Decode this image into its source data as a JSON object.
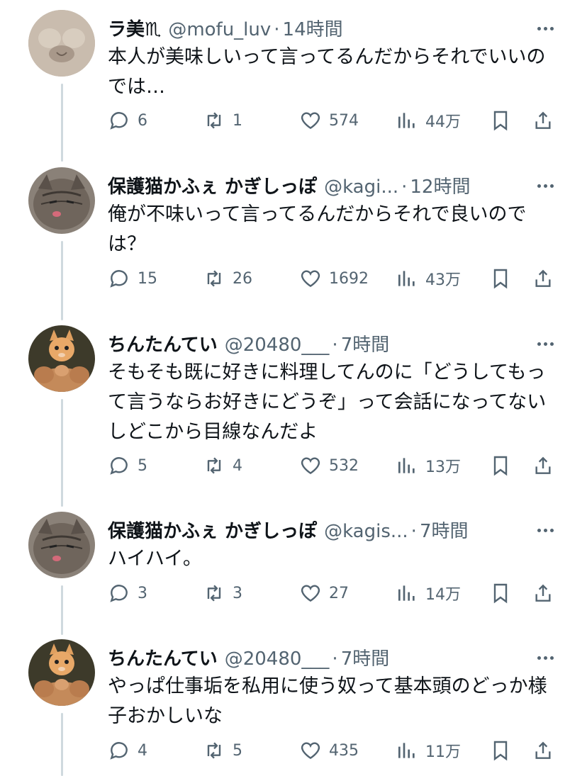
{
  "tweets": [
    {
      "name": "ラ美♏",
      "handle": "@mofu_luv",
      "time": "14時間",
      "text": "本人が美味しいって言ってるんだからそれでいいのでは…",
      "replies": "6",
      "retweets": "1",
      "likes": "574",
      "views": "44万",
      "avatar": "cat-closeup"
    },
    {
      "name": "保護猫かふぇ かぎしっぽ",
      "handle": "@kagi...",
      "time": "12時間",
      "text": "俺が不味いって言ってるんだからそれで良いのでは？",
      "replies": "15",
      "retweets": "26",
      "likes": "1692",
      "views": "43万",
      "avatar": "tabby-cat"
    },
    {
      "name": "ちんたんてい",
      "handle": "@20480___",
      "time": "7時間",
      "text": "そもそも既に好きに料理してんのに「どうしてもって言うならお好きにどうぞ」って会話になってないしどこから目線なんだよ",
      "replies": "5",
      "retweets": "4",
      "likes": "532",
      "views": "13万",
      "avatar": "kitten-muscle"
    },
    {
      "name": "保護猫かふぇ かぎしっぽ",
      "handle": "@kagis...",
      "time": "7時間",
      "text": "ハイハイ。",
      "replies": "3",
      "retweets": "3",
      "likes": "27",
      "views": "14万",
      "avatar": "tabby-cat"
    },
    {
      "name": "ちんたんてい",
      "handle": "@20480___",
      "time": "7時間",
      "text": "やっぱ仕事垢を私用に使う奴って基本頭のどっか様子おかしいな",
      "replies": "4",
      "retweets": "5",
      "likes": "435",
      "views": "11万",
      "avatar": "kitten-muscle"
    }
  ],
  "colors": {
    "text": "#0f1419",
    "secondary": "#536471",
    "thread_line": "#cfd9de"
  }
}
